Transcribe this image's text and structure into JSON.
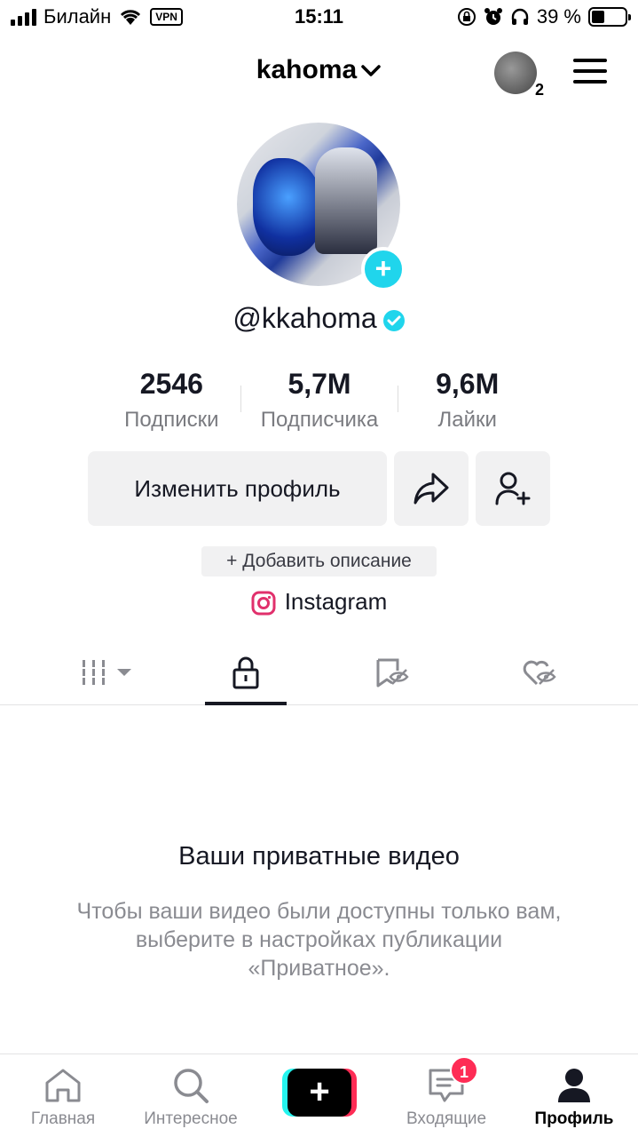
{
  "status_bar": {
    "carrier": "Билайн",
    "vpn": "VPN",
    "time": "15:11",
    "battery_pct": "39 %",
    "battery_level": 0.39
  },
  "header": {
    "username": "kahoma",
    "following_stories_count": "2"
  },
  "profile": {
    "handle": "@kkahoma",
    "verified": true,
    "stats": [
      {
        "value": "2546",
        "label": "Подписки"
      },
      {
        "value": "5,7M",
        "label": "Подписчика"
      },
      {
        "value": "9,6M",
        "label": "Лайки"
      }
    ],
    "edit_profile_label": "Изменить профиль",
    "add_description_label": "+ Добавить описание",
    "instagram_label": "Instagram"
  },
  "tabs": [
    {
      "name": "videos-grid",
      "active": false
    },
    {
      "name": "private",
      "active": true
    },
    {
      "name": "reposts",
      "active": false
    },
    {
      "name": "liked",
      "active": false
    }
  ],
  "empty_state": {
    "title": "Ваши приватные видео",
    "description": "Чтобы ваши видео были доступны только вам, выберите в настройках публикации «Приватное»."
  },
  "bottom_nav": {
    "home": "Главная",
    "discover": "Интересное",
    "inbox": "Входящие",
    "inbox_badge": "1",
    "profile": "Профиль"
  },
  "colors": {
    "accent_cyan": "#20d5ec",
    "brand_pink": "#fe2c55",
    "brand_cyan": "#25f4ee"
  }
}
